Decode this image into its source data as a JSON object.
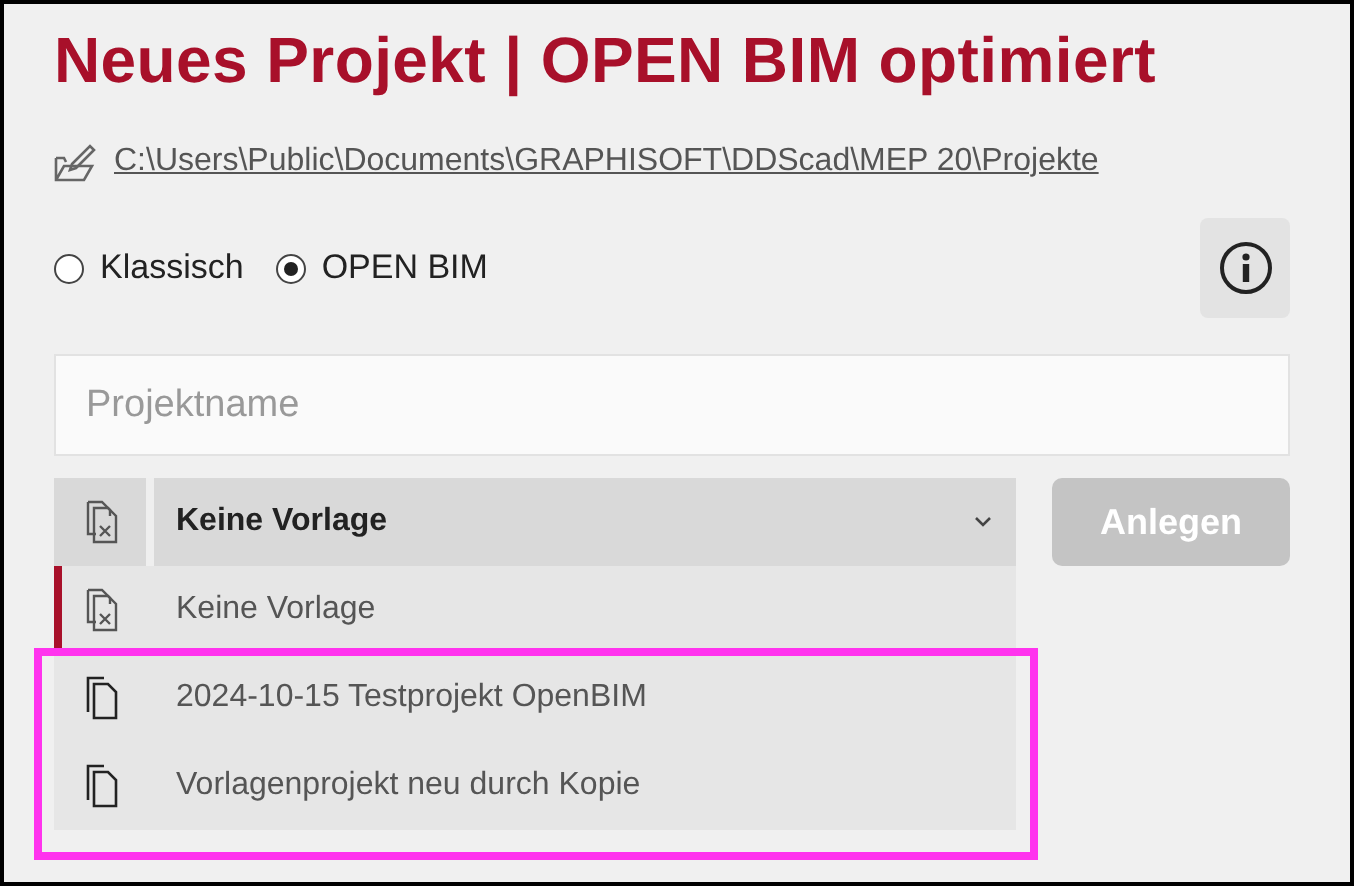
{
  "title": "Neues Projekt | OPEN BIM optimiert",
  "path": "C:\\Users\\Public\\Documents\\GRAPHISOFT\\DDScad\\MEP 20\\Projekte",
  "modes": [
    {
      "label": "Klassisch",
      "selected": false
    },
    {
      "label": "OPEN BIM",
      "selected": true
    }
  ],
  "project_name": {
    "placeholder": "Projektname"
  },
  "template_select": {
    "value": "Keine Vorlage",
    "kind": "empty",
    "expanded": true
  },
  "create_button": {
    "label": "Anlegen",
    "disabled": true
  },
  "templates": [
    {
      "label": "Keine Vorlage",
      "kind": "empty",
      "selected": true
    },
    {
      "label": "2024-10-15 Testprojekt OpenBIM",
      "kind": "project",
      "selected": false
    },
    {
      "label": "Vorlagenprojekt neu durch Kopie",
      "kind": "project",
      "selected": false
    }
  ]
}
